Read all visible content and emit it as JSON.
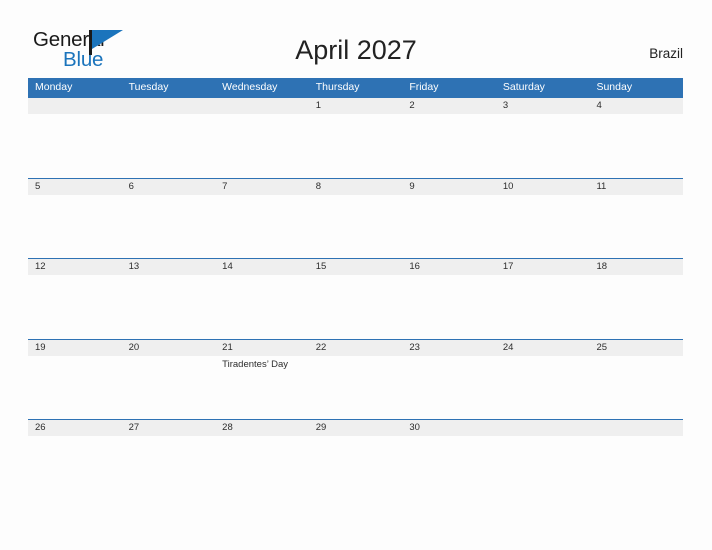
{
  "logo": {
    "word_one": "General",
    "word_two": "Blue",
    "flag_icon": "blue-flag-triangle-icon",
    "accent_color": "#1b74bc"
  },
  "header": {
    "title": "April 2027",
    "country": "Brazil"
  },
  "theme": {
    "header_blue": "#2e72b4",
    "date_band_gray": "#efefef",
    "page_background": "#fdfdfd",
    "text_dark": "#2d2d2d"
  },
  "calendar": {
    "month": "April",
    "year": "2027",
    "weekday_headers": [
      "Monday",
      "Tuesday",
      "Wednesday",
      "Thursday",
      "Friday",
      "Saturday",
      "Sunday"
    ],
    "weeks": [
      {
        "days": [
          {
            "date": "",
            "event": ""
          },
          {
            "date": "",
            "event": ""
          },
          {
            "date": "",
            "event": ""
          },
          {
            "date": "1",
            "event": ""
          },
          {
            "date": "2",
            "event": ""
          },
          {
            "date": "3",
            "event": ""
          },
          {
            "date": "4",
            "event": ""
          }
        ]
      },
      {
        "days": [
          {
            "date": "5",
            "event": ""
          },
          {
            "date": "6",
            "event": ""
          },
          {
            "date": "7",
            "event": ""
          },
          {
            "date": "8",
            "event": ""
          },
          {
            "date": "9",
            "event": ""
          },
          {
            "date": "10",
            "event": ""
          },
          {
            "date": "11",
            "event": ""
          }
        ]
      },
      {
        "days": [
          {
            "date": "12",
            "event": ""
          },
          {
            "date": "13",
            "event": ""
          },
          {
            "date": "14",
            "event": ""
          },
          {
            "date": "15",
            "event": ""
          },
          {
            "date": "16",
            "event": ""
          },
          {
            "date": "17",
            "event": ""
          },
          {
            "date": "18",
            "event": ""
          }
        ]
      },
      {
        "days": [
          {
            "date": "19",
            "event": ""
          },
          {
            "date": "20",
            "event": ""
          },
          {
            "date": "21",
            "event": "Tiradentes’ Day"
          },
          {
            "date": "22",
            "event": ""
          },
          {
            "date": "23",
            "event": ""
          },
          {
            "date": "24",
            "event": ""
          },
          {
            "date": "25",
            "event": ""
          }
        ]
      },
      {
        "days": [
          {
            "date": "26",
            "event": ""
          },
          {
            "date": "27",
            "event": ""
          },
          {
            "date": "28",
            "event": ""
          },
          {
            "date": "29",
            "event": ""
          },
          {
            "date": "30",
            "event": ""
          },
          {
            "date": "",
            "event": ""
          },
          {
            "date": "",
            "event": ""
          }
        ]
      }
    ]
  }
}
